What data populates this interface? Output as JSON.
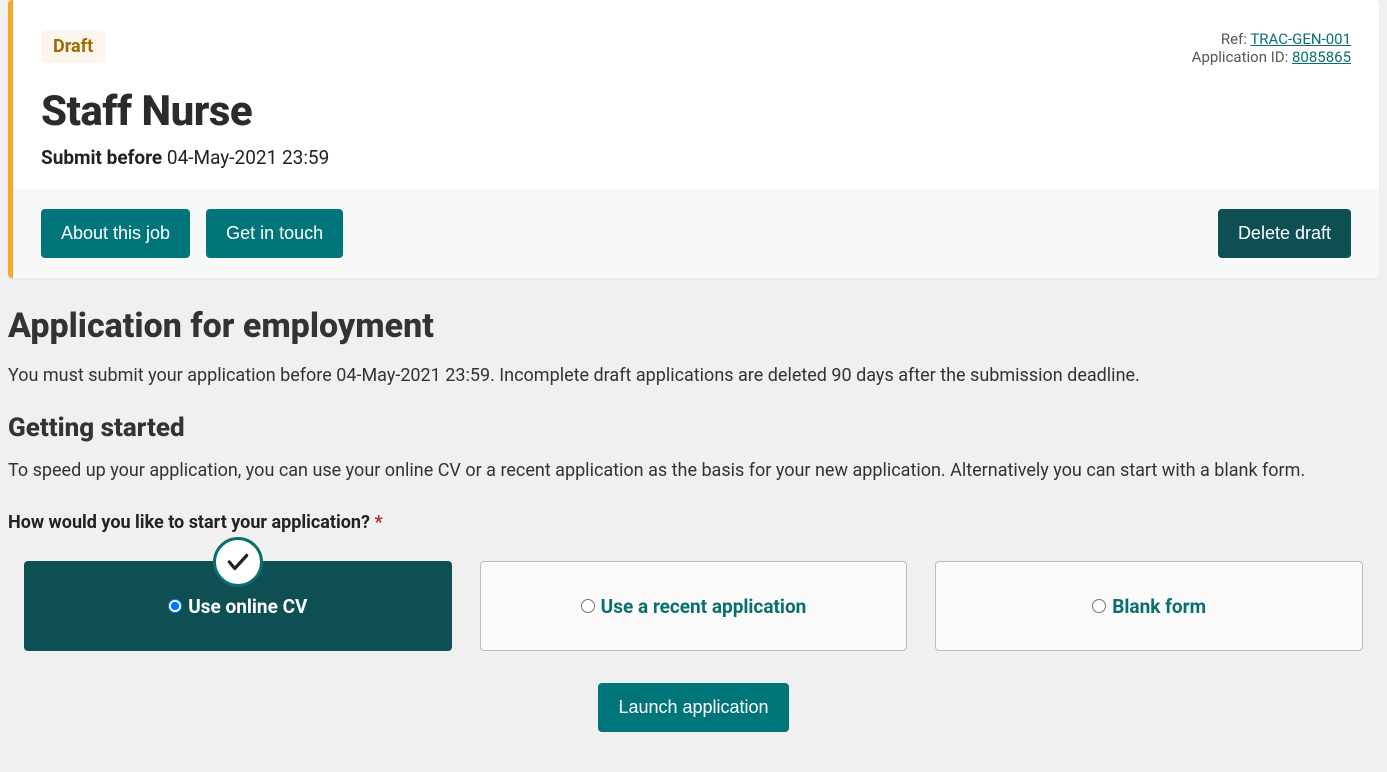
{
  "card": {
    "status_badge": "Draft",
    "ref_label": "Ref: ",
    "ref_value": "TRAC-GEN-001",
    "appid_label": "Application ID: ",
    "appid_value": "8085865",
    "title": "Staff Nurse",
    "submit_label": "Submit before",
    "submit_value": " 04-May-2021 23:59",
    "actions": {
      "about": "About this job",
      "contact": "Get in touch",
      "delete": "Delete draft"
    }
  },
  "main": {
    "heading": "Application for employment",
    "intro": "You must submit your application before 04-May-2021 23:59. Incomplete draft applications are deleted 90 days after the submission deadline.",
    "getting_started_heading": "Getting started",
    "getting_started_text": "To speed up your application, you can use your online CV or a recent application as the basis for your new application. Alternatively you can start with a blank form.",
    "question": "How would you like to start your application? ",
    "asterisk": "*",
    "options": {
      "online_cv": "Use online CV",
      "recent": "Use a recent application",
      "blank": "Blank form"
    },
    "launch": "Launch application"
  }
}
